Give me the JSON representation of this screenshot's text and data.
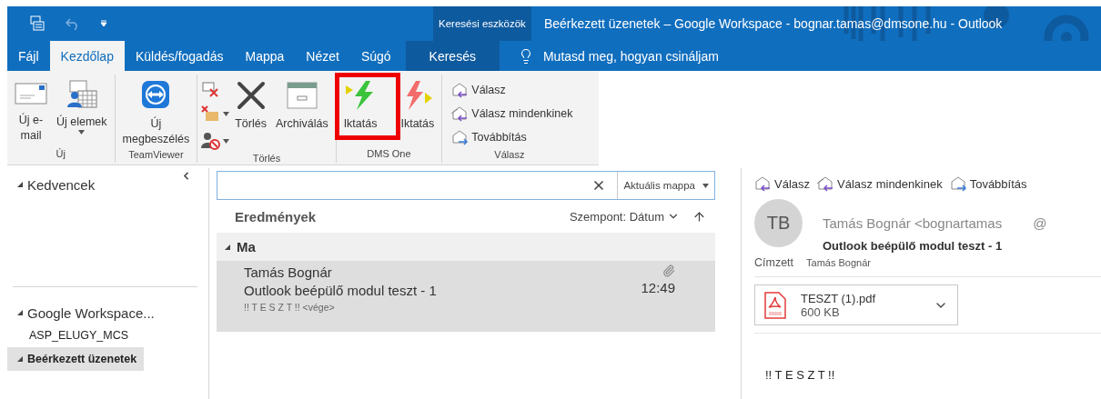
{
  "title_bar": {
    "context_label": "Keresési eszközök",
    "title": "Beérkezett üzenetek – Google Workspace - bognar.tamas@dmsone.hu  -  Outlook"
  },
  "tabs": [
    {
      "label": "Fájl",
      "selected": false,
      "kind": "normal"
    },
    {
      "label": "Kezdőlap",
      "selected": true,
      "kind": "normal"
    },
    {
      "label": "Küldés/fogadás",
      "selected": false,
      "kind": "normal"
    },
    {
      "label": "Mappa",
      "selected": false,
      "kind": "normal"
    },
    {
      "label": "Nézet",
      "selected": false,
      "kind": "normal"
    },
    {
      "label": "Súgó",
      "selected": false,
      "kind": "normal"
    },
    {
      "label": "Keresés",
      "selected": false,
      "kind": "context"
    }
  ],
  "tell_me": {
    "label": "Mutasd meg, hogyan csináljam"
  },
  "ribbon": {
    "groups": [
      {
        "label": "Új",
        "items": [
          {
            "kind": "new_mail",
            "label": "Új e-\nmail",
            "dropdown": false
          },
          {
            "kind": "new_items",
            "label": "Új elemek",
            "dropdown": true
          }
        ]
      },
      {
        "label": "TeamViewer",
        "items": [
          {
            "kind": "teamviewer",
            "label": "Új\nmegbeszélés",
            "dropdown": false
          }
        ]
      },
      {
        "label": "Törlés",
        "items": [
          {
            "kind": "small_stack"
          },
          {
            "kind": "delete",
            "label": "Törlés",
            "dropdown": false
          },
          {
            "kind": "archive",
            "label": "Archiválás",
            "dropdown": false
          }
        ]
      },
      {
        "label": "DMS One",
        "items": [
          {
            "kind": "iktatas_green",
            "label": "Iktatás",
            "dropdown": false,
            "highlighted": true
          },
          {
            "kind": "iktatas_red",
            "label": "Iktatás",
            "dropdown": false,
            "highlighted": false
          }
        ]
      },
      {
        "label": "Válasz",
        "items": [
          {
            "kind": "reply_stack",
            "labels": [
              "Válasz",
              "Válasz mindenkinek",
              "Továbbítás"
            ]
          }
        ]
      }
    ]
  },
  "folders": {
    "favorites": {
      "label": "Kedvencek",
      "expanded": true
    },
    "accounts": [
      {
        "label": "Google Workspace...",
        "expanded": true,
        "children": [
          {
            "label": "ASP_ELUGY_MCS",
            "selected": false
          },
          {
            "label": "Beérkezett üzenetek",
            "selected": true,
            "expanded": true
          }
        ]
      }
    ]
  },
  "message_list": {
    "scope": "Aktuális mappa",
    "heading": "Eredmények",
    "sort": "Szempont: Dátum",
    "groups": [
      {
        "label": "Ma",
        "expanded": true,
        "messages": [
          {
            "sender": "Tamás Bognár",
            "subject": "Outlook beépülő modul teszt - 1",
            "preview": "!! T E S Z T !! <vége>",
            "time": "12:49",
            "attachment": true,
            "selected": true
          }
        ]
      }
    ]
  },
  "reading_pane": {
    "actions": [
      {
        "label": "Válasz",
        "kind": "reply"
      },
      {
        "label": "Válasz mindenkinek",
        "kind": "reply_all"
      },
      {
        "label": "Továbbítás",
        "kind": "forward"
      }
    ],
    "avatar": "TB",
    "from": "Tamás Bognár <bognartamas",
    "from_suffix": "@",
    "subject": "Outlook beépülő modul teszt - 1",
    "to_label": "Címzett",
    "to": "Tamás Bognár",
    "attachment": {
      "name": "TESZT (1).pdf",
      "size": "600 KB"
    },
    "body": "!! T E S Z T !!"
  }
}
